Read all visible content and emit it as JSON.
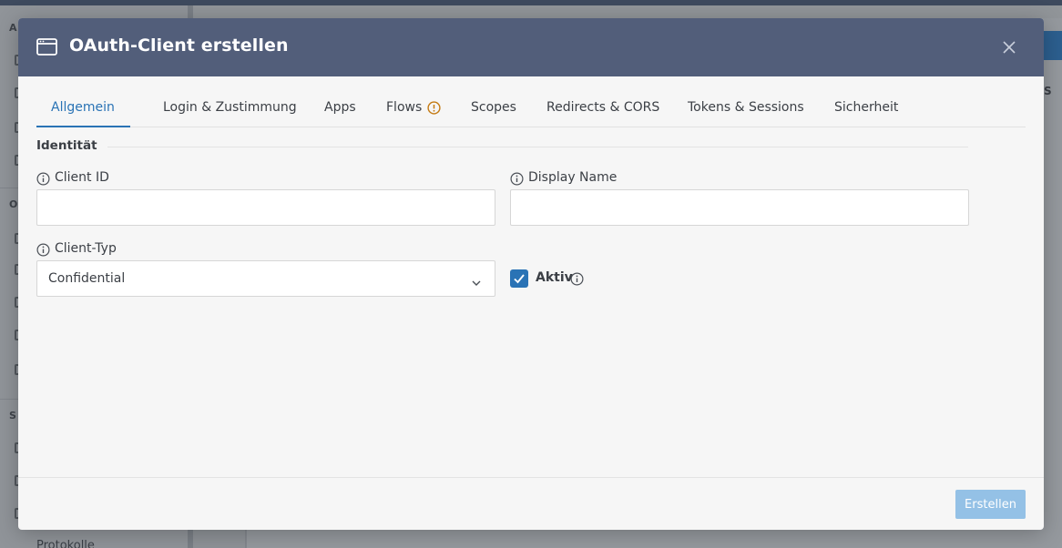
{
  "background": {
    "sidebar_bottom_item": "Protokolle",
    "sidebar_section_letters": [
      "A",
      "O",
      "S"
    ],
    "right_edge_letter": "S"
  },
  "modal": {
    "title": "OAuth-Client erstellen",
    "header_icon": "window-icon",
    "close_icon": "close-icon",
    "tabs": [
      {
        "label": "Allgemein",
        "active": true
      },
      {
        "label": "Login & Zustimmung",
        "active": false
      },
      {
        "label": "Apps",
        "active": false
      },
      {
        "label": "Flows",
        "active": false,
        "badge_icon": "warning-icon"
      },
      {
        "label": "Scopes",
        "active": false
      },
      {
        "label": "Redirects & CORS",
        "active": false
      },
      {
        "label": "Tokens & Sessions",
        "active": false
      },
      {
        "label": "Sicherheit",
        "active": false
      }
    ],
    "section": {
      "title": "Identität"
    },
    "fields": {
      "client_id": {
        "label": "Client ID",
        "value": "",
        "icon": "info-icon"
      },
      "display_name": {
        "label": "Display Name",
        "value": "",
        "icon": "info-icon"
      },
      "client_type": {
        "label": "Client-Typ",
        "value": "Confidential",
        "icon": "info-icon"
      },
      "active": {
        "label": "Aktiv",
        "checked": true,
        "icon": "info-icon"
      }
    },
    "submit_label": "Erstellen"
  },
  "colors": {
    "header_bg": "#525e7a",
    "accent": "#2a73b5",
    "submit_disabled": "#94c1e6",
    "warning": "#c47a12"
  }
}
